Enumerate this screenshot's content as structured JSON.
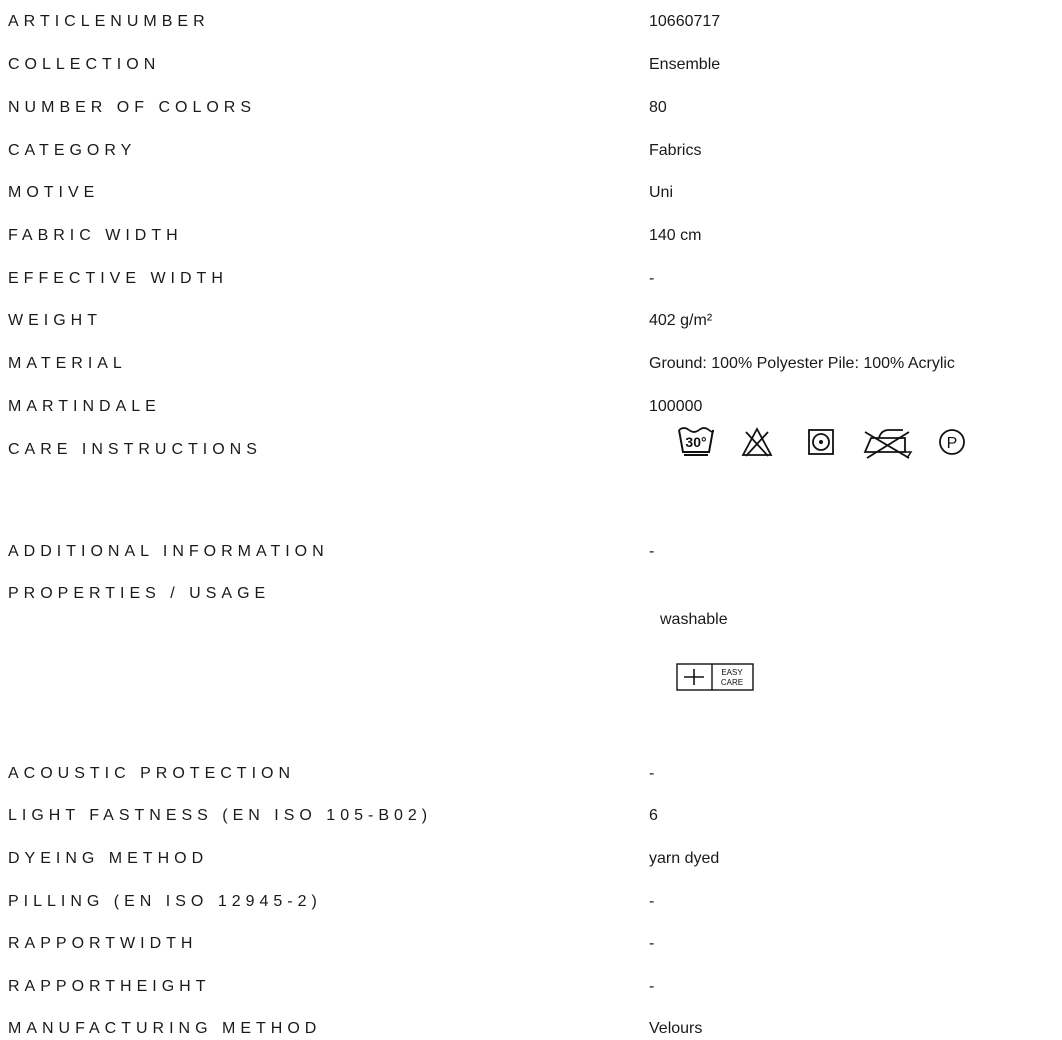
{
  "specs": [
    {
      "label": "ARTICLENUMBER",
      "value": "10660717"
    },
    {
      "label": "COLLECTION",
      "value": "Ensemble"
    },
    {
      "label": "NUMBER OF COLORS",
      "value": "80"
    },
    {
      "label": "CATEGORY",
      "value": "Fabrics"
    },
    {
      "label": "MOTIVE",
      "value": "Uni"
    },
    {
      "label": "FABRIC WIDTH",
      "value": "140 cm"
    },
    {
      "label": "EFFECTIVE WIDTH",
      "value": "-"
    },
    {
      "label": "WEIGHT",
      "value": "402 g/m²"
    },
    {
      "label": "MATERIAL",
      "value": "Ground: 100% Polyester Pile: 100% Acrylic"
    },
    {
      "label": "MARTINDALE",
      "value": "100000"
    },
    {
      "label": "CARE INSTRUCTIONS",
      "icons": [
        "wash-30-icon",
        "do-not-bleach-icon",
        "tumble-dry-icon",
        "do-not-iron-icon",
        "professional-cleaning-p-icon"
      ],
      "wash_temp": "30°",
      "dry_clean_letter": "P"
    },
    {
      "label": "ADDITIONAL INFORMATION",
      "value": "-"
    },
    {
      "label": "PROPERTIES / USAGE",
      "value": "washable",
      "badge": {
        "icon": "plus-icon",
        "line1": "EASY",
        "line2": "CARE"
      }
    },
    {
      "label": "ACOUSTIC PROTECTION",
      "value": "-"
    },
    {
      "label": "LIGHT FASTNESS (EN ISO 105-B02)",
      "value": "6"
    },
    {
      "label": "DYEING METHOD",
      "value": "yarn dyed"
    },
    {
      "label": "PILLING (EN ISO 12945-2)",
      "value": "-"
    },
    {
      "label": "RAPPORTWIDTH",
      "value": "-"
    },
    {
      "label": "RAPPORTHEIGHT",
      "value": "-"
    },
    {
      "label": "MANUFACTURING METHOD",
      "value": "Velours"
    }
  ]
}
